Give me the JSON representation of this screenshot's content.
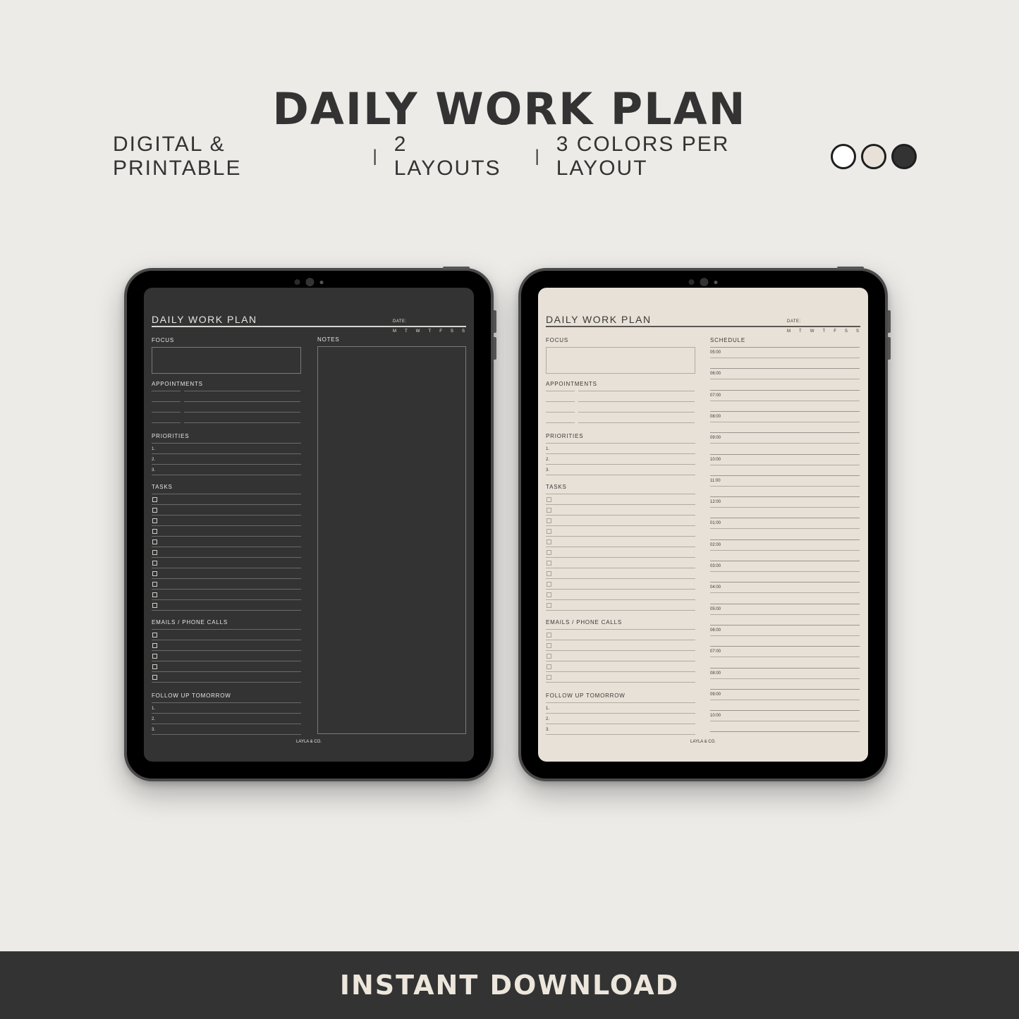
{
  "header": {
    "title": "DAILY WORK PLAN",
    "subtitle_parts": [
      "DIGITAL & PRINTABLE",
      "2 LAYOUTS",
      "3 COLORS PER LAYOUT"
    ],
    "separator": "|",
    "color_swatches": [
      {
        "name": "white",
        "color": "#ffffff"
      },
      {
        "name": "beige",
        "color": "#e7e1d8"
      },
      {
        "name": "charcoal",
        "color": "#333333"
      }
    ]
  },
  "planner": {
    "title": "DAILY WORK PLAN",
    "date_label": "DATE:",
    "days": [
      "M",
      "T",
      "W",
      "T",
      "F",
      "S",
      "S"
    ],
    "focus_label": "FOCUS",
    "appointments_label": "APPOINTMENTS",
    "priorities_label": "PRIORITIES",
    "priority_numbers": [
      "1.",
      "2.",
      "3."
    ],
    "tasks_label": "TASKS",
    "task_count": 11,
    "emails_label": "EMAILS / PHONE CALLS",
    "email_count": 5,
    "follow_up_label": "FOLLOW UP TOMORROW",
    "follow_up_numbers": [
      "1.",
      "2.",
      "3."
    ],
    "notes_label": "NOTES",
    "schedule_label": "SCHEDULE",
    "schedule_times": [
      "05:00",
      "06:00",
      "07:00",
      "08:00",
      "09:00",
      "10:00",
      "11:00",
      "12:00",
      "01:00",
      "02:00",
      "03:00",
      "04:00",
      "05:00",
      "06:00",
      "07:00",
      "08:00",
      "09:00",
      "10:00"
    ],
    "brand": "LAYLA & CO."
  },
  "layouts": [
    {
      "name": "notes-layout",
      "theme": "dark",
      "bg": "#333333"
    },
    {
      "name": "schedule-layout",
      "theme": "light",
      "bg": "#e7e1d8"
    }
  ],
  "banner": {
    "text": "INSTANT DOWNLOAD"
  }
}
